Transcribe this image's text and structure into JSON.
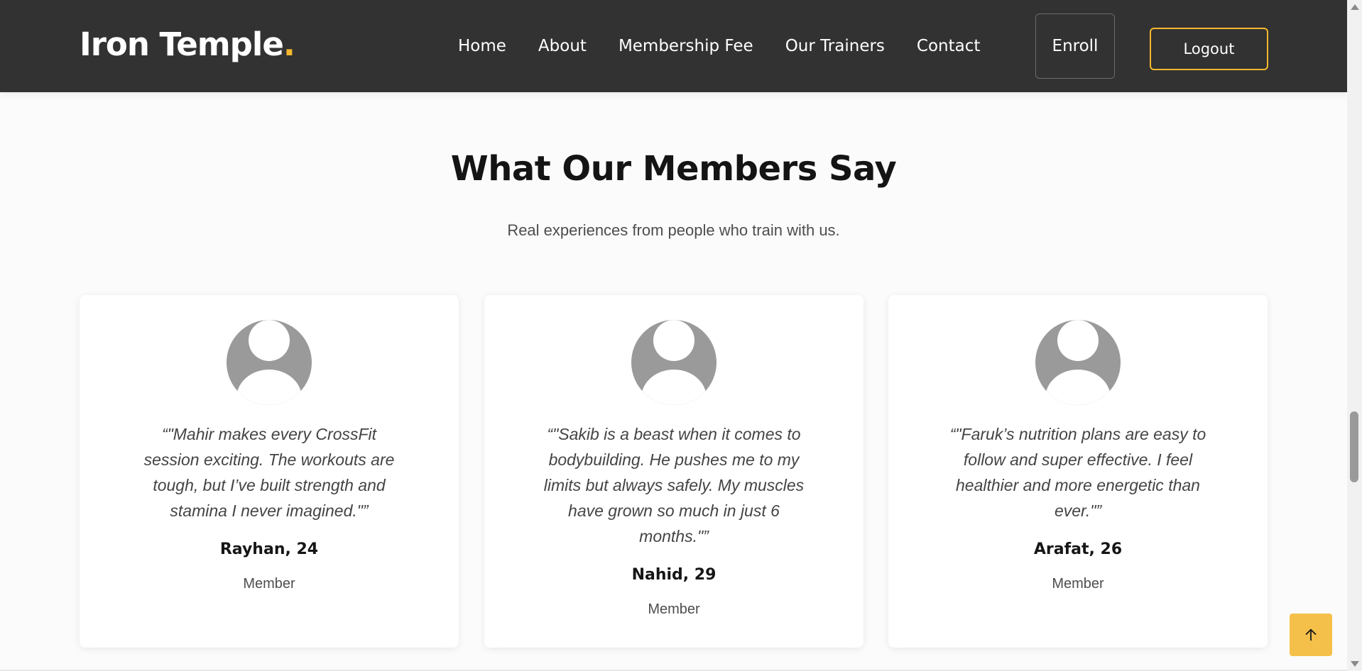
{
  "brand": {
    "name": "Iron Temple",
    "dot": "."
  },
  "nav": {
    "links": [
      "Home",
      "About",
      "Membership Fee",
      "Our Trainers",
      "Contact"
    ],
    "enroll": "Enroll",
    "logout": "Logout"
  },
  "section": {
    "title": "What Our Members Say",
    "subtitle": "Real experiences from people who train with us."
  },
  "testimonials": [
    {
      "quote": "“\"Mahir makes every CrossFit session exciting. The workouts are tough, but I’ve built strength and stamina I never imagined.\"”",
      "name": "Rayhan, 24",
      "role": "Member"
    },
    {
      "quote": "“\"Sakib is a beast when it comes to bodybuilding. He pushes me to my limits but always safely. My muscles have grown so much in just 6 months.\"”",
      "name": "Nahid, 29",
      "role": "Member"
    },
    {
      "quote": "“\"Faruk’s nutrition plans are easy to follow and super effective. I feel healthier and more energetic than ever.\"”",
      "name": "Arafat, 26",
      "role": "Member"
    }
  ],
  "colors": {
    "accent": "#f5b82e",
    "navbar": "#323232",
    "peek_bar": "#0e1a3d"
  },
  "icons": {
    "avatar": "user-avatar-icon",
    "to_top": "arrow-up-icon"
  }
}
